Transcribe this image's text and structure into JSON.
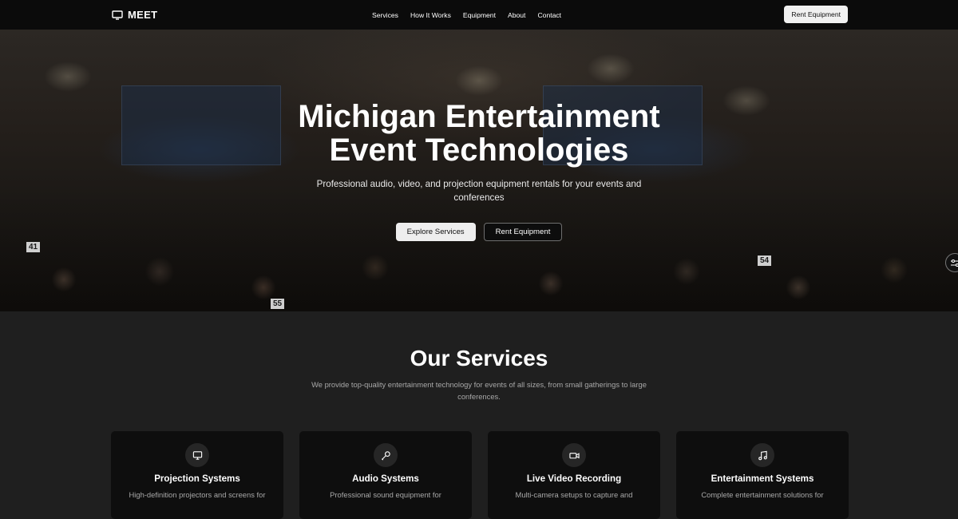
{
  "nav": {
    "brand": "MEET",
    "links": [
      "Services",
      "How It Works",
      "Equipment",
      "About",
      "Contact"
    ],
    "cta": "Rent Equipment"
  },
  "hero": {
    "title_line1": "Michigan Entertainment",
    "title_line2": "Event Technologies",
    "subtitle": "Professional audio, video, and projection equipment rentals for your events and conferences",
    "primary_button": "Explore Services",
    "secondary_button": "Rent Equipment",
    "table_numbers": [
      "41",
      "55",
      "54"
    ]
  },
  "services": {
    "title": "Our Services",
    "subtitle": "We provide top-quality entertainment technology for events of all sizes, from small gatherings to large conferences.",
    "cards": [
      {
        "icon": "monitor-icon",
        "title": "Projection Systems",
        "desc": "High-definition projectors and screens for"
      },
      {
        "icon": "microphone-icon",
        "title": "Audio Systems",
        "desc": "Professional sound equipment for"
      },
      {
        "icon": "video-camera-icon",
        "title": "Live Video Recording",
        "desc": "Multi-camera setups to capture and"
      },
      {
        "icon": "music-note-icon",
        "title": "Entertainment Systems",
        "desc": "Complete entertainment solutions for"
      }
    ]
  }
}
